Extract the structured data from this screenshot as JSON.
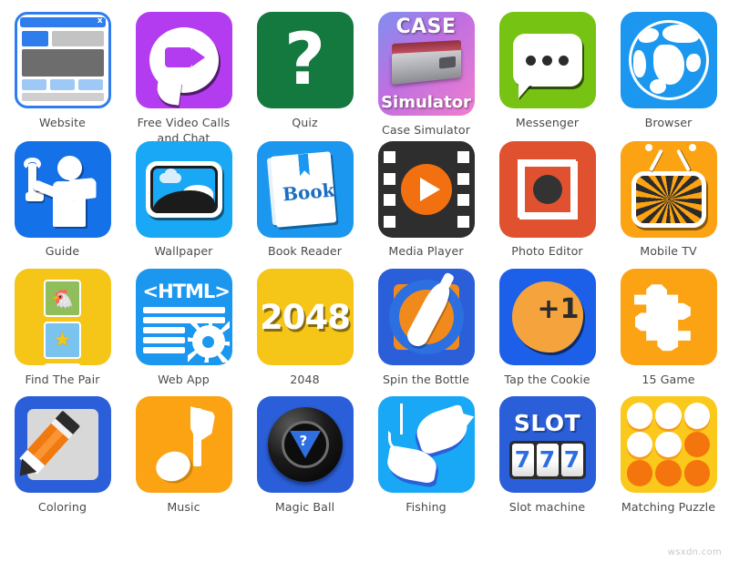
{
  "page": {
    "background": "#ffffff",
    "watermark": "wsxdn.com",
    "label_color": "#4a4a4a",
    "columns": 6,
    "rows": 4
  },
  "apps": [
    {
      "id": "website",
      "label": "Website",
      "tile_color": "#ffffff",
      "accent": "#2f7ced",
      "icon": "browser-window-icon",
      "close_glyph": "x"
    },
    {
      "id": "video_calls",
      "label": "Free Video Calls and Chat",
      "tile_color": "#b43cf0",
      "accent": "#ffffff",
      "icon": "video-chat-bubble-icon"
    },
    {
      "id": "quiz",
      "label": "Quiz",
      "tile_color": "#14793f",
      "accent": "#ffffff",
      "icon": "question-mark-icon",
      "glyph": "?"
    },
    {
      "id": "case_simulator",
      "label": "Case Simulator",
      "tile_color": "#c06fe0",
      "accent": "#ffffff",
      "icon": "weapon-crate-icon",
      "top_text": "CASE",
      "bottom_text": "Simulator"
    },
    {
      "id": "messenger",
      "label": "Messenger",
      "tile_color": "#76c313",
      "accent": "#ffffff",
      "icon": "chat-bubble-dots-icon"
    },
    {
      "id": "browser",
      "label": "Browser",
      "tile_color": "#1b97f0",
      "accent": "#ffffff",
      "icon": "globe-icon"
    },
    {
      "id": "guide",
      "label": "Guide",
      "tile_color": "#1571e8",
      "accent": "#ffffff",
      "icon": "person-wrench-book-icon"
    },
    {
      "id": "wallpaper",
      "label": "Wallpaper",
      "tile_color": "#19a8f5",
      "accent": "#ffffff",
      "icon": "landscape-photo-icon"
    },
    {
      "id": "book_reader",
      "label": "Book Reader",
      "tile_color": "#1b97f0",
      "accent": "#ffffff",
      "icon": "book-icon",
      "cover_text": "Book"
    },
    {
      "id": "media_player",
      "label": "Media Player",
      "tile_color": "#2e2e2e",
      "accent": "#f2700f",
      "icon": "film-play-icon"
    },
    {
      "id": "photo_editor",
      "label": "Photo Editor",
      "tile_color": "#e0522f",
      "accent": "#ffffff",
      "icon": "camera-crop-icon"
    },
    {
      "id": "mobile_tv",
      "label": "Mobile TV",
      "tile_color": "#fba313",
      "accent": "#ffffff",
      "icon": "retro-tv-icon"
    },
    {
      "id": "find_the_pair",
      "label": "Find The Pair",
      "tile_color": "#f5c518",
      "accent": "#ffffff",
      "icon": "memory-cards-icon",
      "cards": [
        "pony",
        "star",
        "star",
        "pony"
      ]
    },
    {
      "id": "web_app",
      "label": "Web App",
      "tile_color": "#1b97f0",
      "accent": "#ffffff",
      "icon": "html-gear-icon",
      "code_text": "<HTML>"
    },
    {
      "id": "game_2048",
      "label": "2048",
      "tile_color": "#f5c518",
      "accent": "#ffffff",
      "icon": "number-tile-icon",
      "glyph": "2048"
    },
    {
      "id": "spin_the_bottle",
      "label": "Spin the Bottle",
      "tile_color": "#2b5fd9",
      "accent": "#f08a1c",
      "icon": "spinning-bottle-icon"
    },
    {
      "id": "tap_the_cookie",
      "label": "Tap the Cookie",
      "tile_color": "#1c5fe8",
      "accent": "#f5a33c",
      "icon": "cookie-icon",
      "glyph": "+1"
    },
    {
      "id": "game_15",
      "label": "15 Game",
      "tile_color": "#fba313",
      "accent": "#ffffff",
      "icon": "puzzle-piece-icon"
    },
    {
      "id": "coloring",
      "label": "Coloring",
      "tile_color": "#2b5fd9",
      "accent": "#f07a10",
      "icon": "pencil-canvas-icon"
    },
    {
      "id": "music",
      "label": "Music",
      "tile_color": "#fba313",
      "accent": "#ffffff",
      "icon": "music-note-icon"
    },
    {
      "id": "magic_ball",
      "label": "Magic Ball",
      "tile_color": "#2b5fd9",
      "accent": "#2f6fe0",
      "icon": "magic-8-ball-icon",
      "glyph": "?"
    },
    {
      "id": "fishing",
      "label": "Fishing",
      "tile_color": "#19a8f5",
      "accent": "#ffffff",
      "icon": "fish-hook-icon"
    },
    {
      "id": "slot_machine",
      "label": "Slot machine",
      "tile_color": "#2b5fd9",
      "accent": "#ffffff",
      "icon": "slot-reels-icon",
      "title_text": "SLOT",
      "reels": [
        "7",
        "7",
        "7"
      ]
    },
    {
      "id": "matching_puzzle",
      "label": "Matching Puzzle",
      "tile_color": "#fbc91b",
      "accent": "#f4750d",
      "icon": "chip-grid-icon",
      "chips": [
        "w",
        "w",
        "w",
        "w",
        "w",
        "o",
        "o",
        "o",
        "o"
      ]
    }
  ]
}
